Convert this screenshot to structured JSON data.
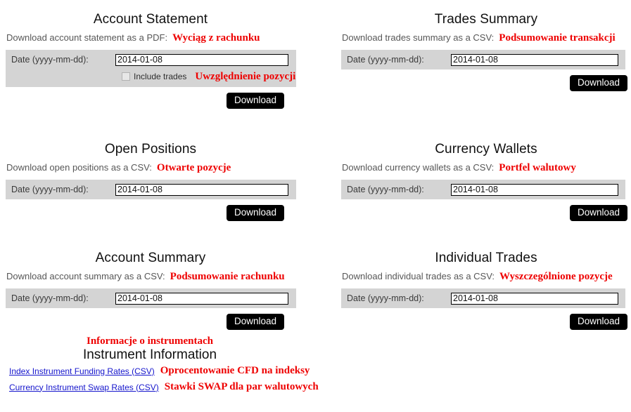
{
  "colors": {
    "annotation_red": "#ee0000",
    "link_blue": "#1414cc",
    "panel_gray": "#d4d4d4",
    "button_black": "#000000",
    "description_gray": "#575757"
  },
  "common": {
    "date_label": "Date (yyyy-mm-dd):",
    "date_value": "2014-01-08",
    "download_label": "Download"
  },
  "sections": [
    {
      "id": "account-statement",
      "title": "Account Statement",
      "description": "Download account statement as a PDF:",
      "annotation": "Wyciąg z rachunku",
      "date_label": "Date (yyyy-mm-dd):",
      "date_value": "2014-01-08",
      "checkbox_label": "Include trades",
      "checkbox_annotation": "Uwzględnienie pozycji",
      "checkbox_checked": false,
      "download_label": "Download"
    },
    {
      "id": "trades-summary",
      "title": "Trades Summary",
      "description": "Download trades summary as a CSV:",
      "annotation": "Podsumowanie transakcji",
      "date_label": "Date (yyyy-mm-dd):",
      "date_value": "2014-01-08",
      "download_label": "Download"
    },
    {
      "id": "open-positions",
      "title": "Open Positions",
      "description": "Download open positions as a CSV:",
      "annotation": "Otwarte pozycje",
      "date_label": "Date (yyyy-mm-dd):",
      "date_value": "2014-01-08",
      "download_label": "Download"
    },
    {
      "id": "currency-wallets",
      "title": "Currency Wallets",
      "description": "Download currency wallets as a CSV:",
      "annotation": "Portfel walutowy",
      "date_label": "Date (yyyy-mm-dd):",
      "date_value": "2014-01-08",
      "download_label": "Download"
    },
    {
      "id": "account-summary",
      "title": "Account Summary",
      "description": "Download account summary as a CSV:",
      "annotation": "Podsumowanie rachunku",
      "date_label": "Date (yyyy-mm-dd):",
      "date_value": "2014-01-08",
      "download_label": "Download"
    },
    {
      "id": "individual-trades",
      "title": "Individual Trades",
      "description": "Download individual trades as a CSV:",
      "annotation": "Wyszczególnione pozycje",
      "date_label": "Date (yyyy-mm-dd):",
      "date_value": "2014-01-08",
      "download_label": "Download"
    }
  ],
  "instrument_information": {
    "annotation": "Informacje o instrumentach",
    "title": "Instrument Information",
    "links": [
      {
        "label": "Index Instrument Funding Rates (CSV)",
        "annotation": "Oprocentowanie CFD na indeksy"
      },
      {
        "label": "Currency Instrument Swap Rates (CSV)",
        "annotation": "Stawki SWAP dla par walutowych"
      }
    ]
  }
}
